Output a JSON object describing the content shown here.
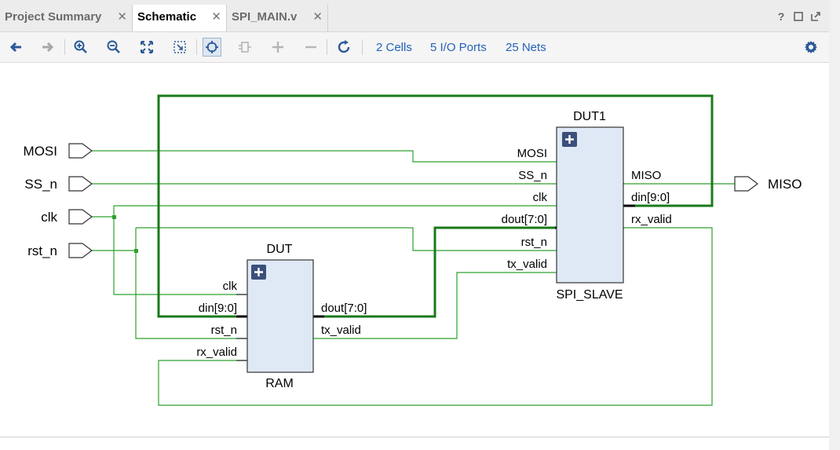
{
  "tabs": [
    {
      "label": "Project Summary",
      "close": "✕"
    },
    {
      "label": "Schematic",
      "close": "✕"
    },
    {
      "label": "SPI_MAIN.v",
      "close": "✕"
    }
  ],
  "window_buttons": {
    "help": "?"
  },
  "toolbar": {
    "links": {
      "cells": "2 Cells",
      "io_ports": "5 I/O Ports",
      "nets": "25 Nets"
    },
    "icons": [
      "back-arrow-icon",
      "forward-arrow-icon",
      "zoom-in-icon",
      "zoom-out-icon",
      "zoom-fit-icon",
      "zoom-selection-icon",
      "select-icon",
      "expand-cell-icon",
      "add-icon",
      "remove-icon",
      "refresh-icon",
      "settings-gear-icon"
    ]
  },
  "schematic": {
    "ports": {
      "mosi": "MOSI",
      "ss_n": "SS_n",
      "clk": "clk",
      "rst_n": "rst_n",
      "miso": "MISO"
    },
    "dut1": {
      "instance": "DUT1",
      "module": "SPI_SLAVE",
      "pins_in": {
        "mosi": "MOSI",
        "ss_n": "SS_n",
        "clk": "clk",
        "dout": "dout[7:0]",
        "rst_n": "rst_n",
        "tx_valid": "tx_valid"
      },
      "pins_out": {
        "miso": "MISO",
        "din": "din[9:0]",
        "rx_valid": "rx_valid"
      }
    },
    "dut": {
      "instance": "DUT",
      "module": "RAM",
      "pins_in": {
        "clk": "clk",
        "din": "din[9:0]",
        "rst_n": "rst_n",
        "rx_valid": "rx_valid"
      },
      "pins_out": {
        "dout": "dout[7:0]",
        "tx_valid": "tx_valid"
      }
    },
    "colors": {
      "wire": "#2ea02e",
      "bus": "#1a7a1a",
      "block_fill": "#dfe9f6",
      "block_stroke": "#333333",
      "expand_button": "#3a4f7a"
    }
  }
}
